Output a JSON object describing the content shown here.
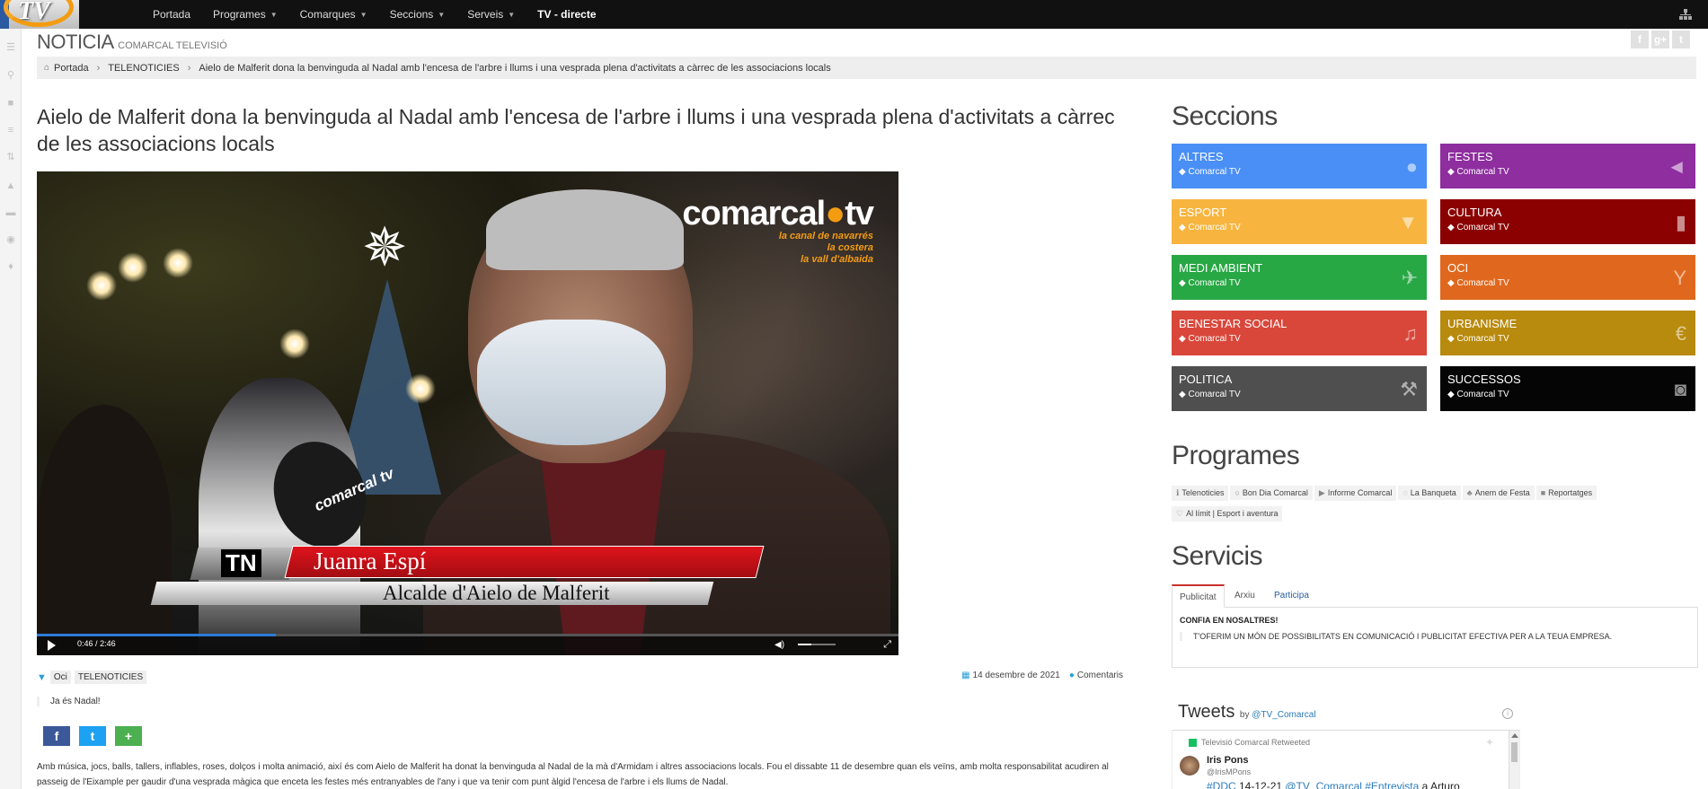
{
  "nav": {
    "logo_text": "TV",
    "items": [
      {
        "label": "Portada",
        "caret": false
      },
      {
        "label": "Programes",
        "caret": true
      },
      {
        "label": "Comarques",
        "caret": true
      },
      {
        "label": "Seccions",
        "caret": true
      },
      {
        "label": "Serveis",
        "caret": true
      },
      {
        "label": "TV - directe",
        "caret": false
      }
    ]
  },
  "header": {
    "title": "NOTICIA",
    "subtitle": "COMARCAL TELEVISIÓ",
    "social": [
      "f",
      "g+",
      "t"
    ]
  },
  "breadcrumb": {
    "items": [
      "Portada",
      "TELENOTICIES",
      "Aielo de Malferit dona la benvinguda al Nadal amb l'encesa de l'arbre i llums i una vesprada plena d'activitats a càrrec de les associacions locals"
    ]
  },
  "article": {
    "title": "Aielo de Malferit dona la benvinguda al Nadal amb l'encesa de l'arbre i llums i una vesprada plena d'activitats a càrrec de les associacions locals",
    "video": {
      "watermark_main": "comarcal",
      "watermark_dot": "●",
      "watermark_tv": "tv",
      "watermark_lines": [
        "la canal de navarrés",
        "la costera",
        "la vall d'albaida"
      ],
      "mic_label": "comarcal",
      "mic_tv": "tv",
      "lower_third_logo": "TN",
      "lower_third_name": "Juanra Espí",
      "lower_third_role": "Alcalde d'Aielo de Malferit",
      "current_time": "0:46",
      "time_sep": "/",
      "duration": "2:46",
      "progress": 0.277,
      "volume": 0.35
    },
    "tags": [
      "Oci",
      "TELENOTICIES"
    ],
    "date": "14 desembre de 2021",
    "comments_label": "Comentaris",
    "lead": "Ja és Nadal!",
    "share": [
      {
        "label": "f",
        "color": "#3b5998"
      },
      {
        "label": "t",
        "color": "#1da1f2"
      },
      {
        "label": "+",
        "color": "#4caf50"
      }
    ],
    "body": "Amb música, jocs, balls, tallers, inflables, roses, dolços i molta animació, així és com Aielo de Malferit ha donat la benvinguda al Nadal de la mà d'Armidam i altres associacions locals. Fou el dissabte 11 de desembre quan els veïns, amb molta responsabilitat acudiren al passeig de l'Eixample per gaudir d'una vesprada màgica que enceta les festes més entranyables de l'any i que va tenir com punt àlgid l'encesa de l'arbre i els llums de Nadal."
  },
  "sidebar": {
    "sections_title": "Seccions",
    "sections": [
      {
        "title": "ALTRES",
        "sub": "Comarcal TV",
        "color": "#4a8ff5",
        "icon": "globe-icon",
        "glyph": "●"
      },
      {
        "title": "FESTES",
        "sub": "Comarcal TV",
        "color": "#8e2e9f",
        "icon": "megaphone-icon",
        "glyph": "◄"
      },
      {
        "title": "ESPORT",
        "sub": "Comarcal TV",
        "color": "#f7b540",
        "icon": "trophy-icon",
        "glyph": "▼"
      },
      {
        "title": "CULTURA",
        "sub": "Comarcal TV",
        "color": "#8b0000",
        "icon": "book-icon",
        "glyph": "▮"
      },
      {
        "title": "MEDI AMBIENT",
        "sub": "Comarcal TV",
        "color": "#28a745",
        "icon": "plane-icon",
        "glyph": "✈"
      },
      {
        "title": "OCI",
        "sub": "Comarcal TV",
        "color": "#e0681e",
        "icon": "cocktail-icon",
        "glyph": "Y"
      },
      {
        "title": "BENESTAR SOCIAL",
        "sub": "Comarcal TV",
        "color": "#d9473b",
        "icon": "music-icon",
        "glyph": "♫"
      },
      {
        "title": "URBANISME",
        "sub": "Comarcal TV",
        "color": "#b88a0d",
        "icon": "euro-icon",
        "glyph": "€"
      },
      {
        "title": "POLITICA",
        "sub": "Comarcal TV",
        "color": "#4f4f4f",
        "icon": "gavel-icon",
        "glyph": "⚒"
      },
      {
        "title": "SUCCESSOS",
        "sub": "Comarcal TV",
        "color": "#050505",
        "icon": "camera-icon",
        "glyph": "◙"
      }
    ],
    "programs_title": "Programes",
    "programs": [
      {
        "label": "Telenoticies",
        "icon": "info-icon",
        "glyph": "ℹ"
      },
      {
        "label": "Bon Dia Comarcal",
        "icon": "circle-icon",
        "glyph": "○"
      },
      {
        "label": "Informe Comarcal",
        "icon": "play-icon",
        "glyph": "▶"
      },
      {
        "label": "La Banqueta",
        "icon": "comment-icon",
        "glyph": "◌"
      },
      {
        "label": "Anem de Festa",
        "icon": "users-icon",
        "glyph": "♣"
      },
      {
        "label": "Reportatges",
        "icon": "video-icon",
        "glyph": "■"
      },
      {
        "label": "Al límit | Esport i aventura",
        "icon": "heart-icon",
        "glyph": "♡"
      }
    ],
    "services_title": "Servicis",
    "services_tabs": [
      "Publicitat",
      "Arxiu",
      "Participa"
    ],
    "services_heading": "CONFIA EN NOSALTRES!",
    "services_text": "T'OFERIM UN MÓN DE POSSIBILITATS EN COMUNICACIÓ I PUBLICITAT EFECTIVA PER A LA TEUA EMPRESA.",
    "tweets": {
      "title": "Tweets",
      "by": "by",
      "handle": "@TV_Comarcal",
      "retweet_label": "Televisió Comarcal Retweeted",
      "author": "Iris Pons",
      "author_handle": "@IrisMPons",
      "text_tag": "#DDC",
      "text_date": " 14-12-21 ",
      "text_mention": "@TV_Comarcal",
      "text_tag2": " #Entrevista",
      "text_tail": " a Arturo"
    }
  }
}
